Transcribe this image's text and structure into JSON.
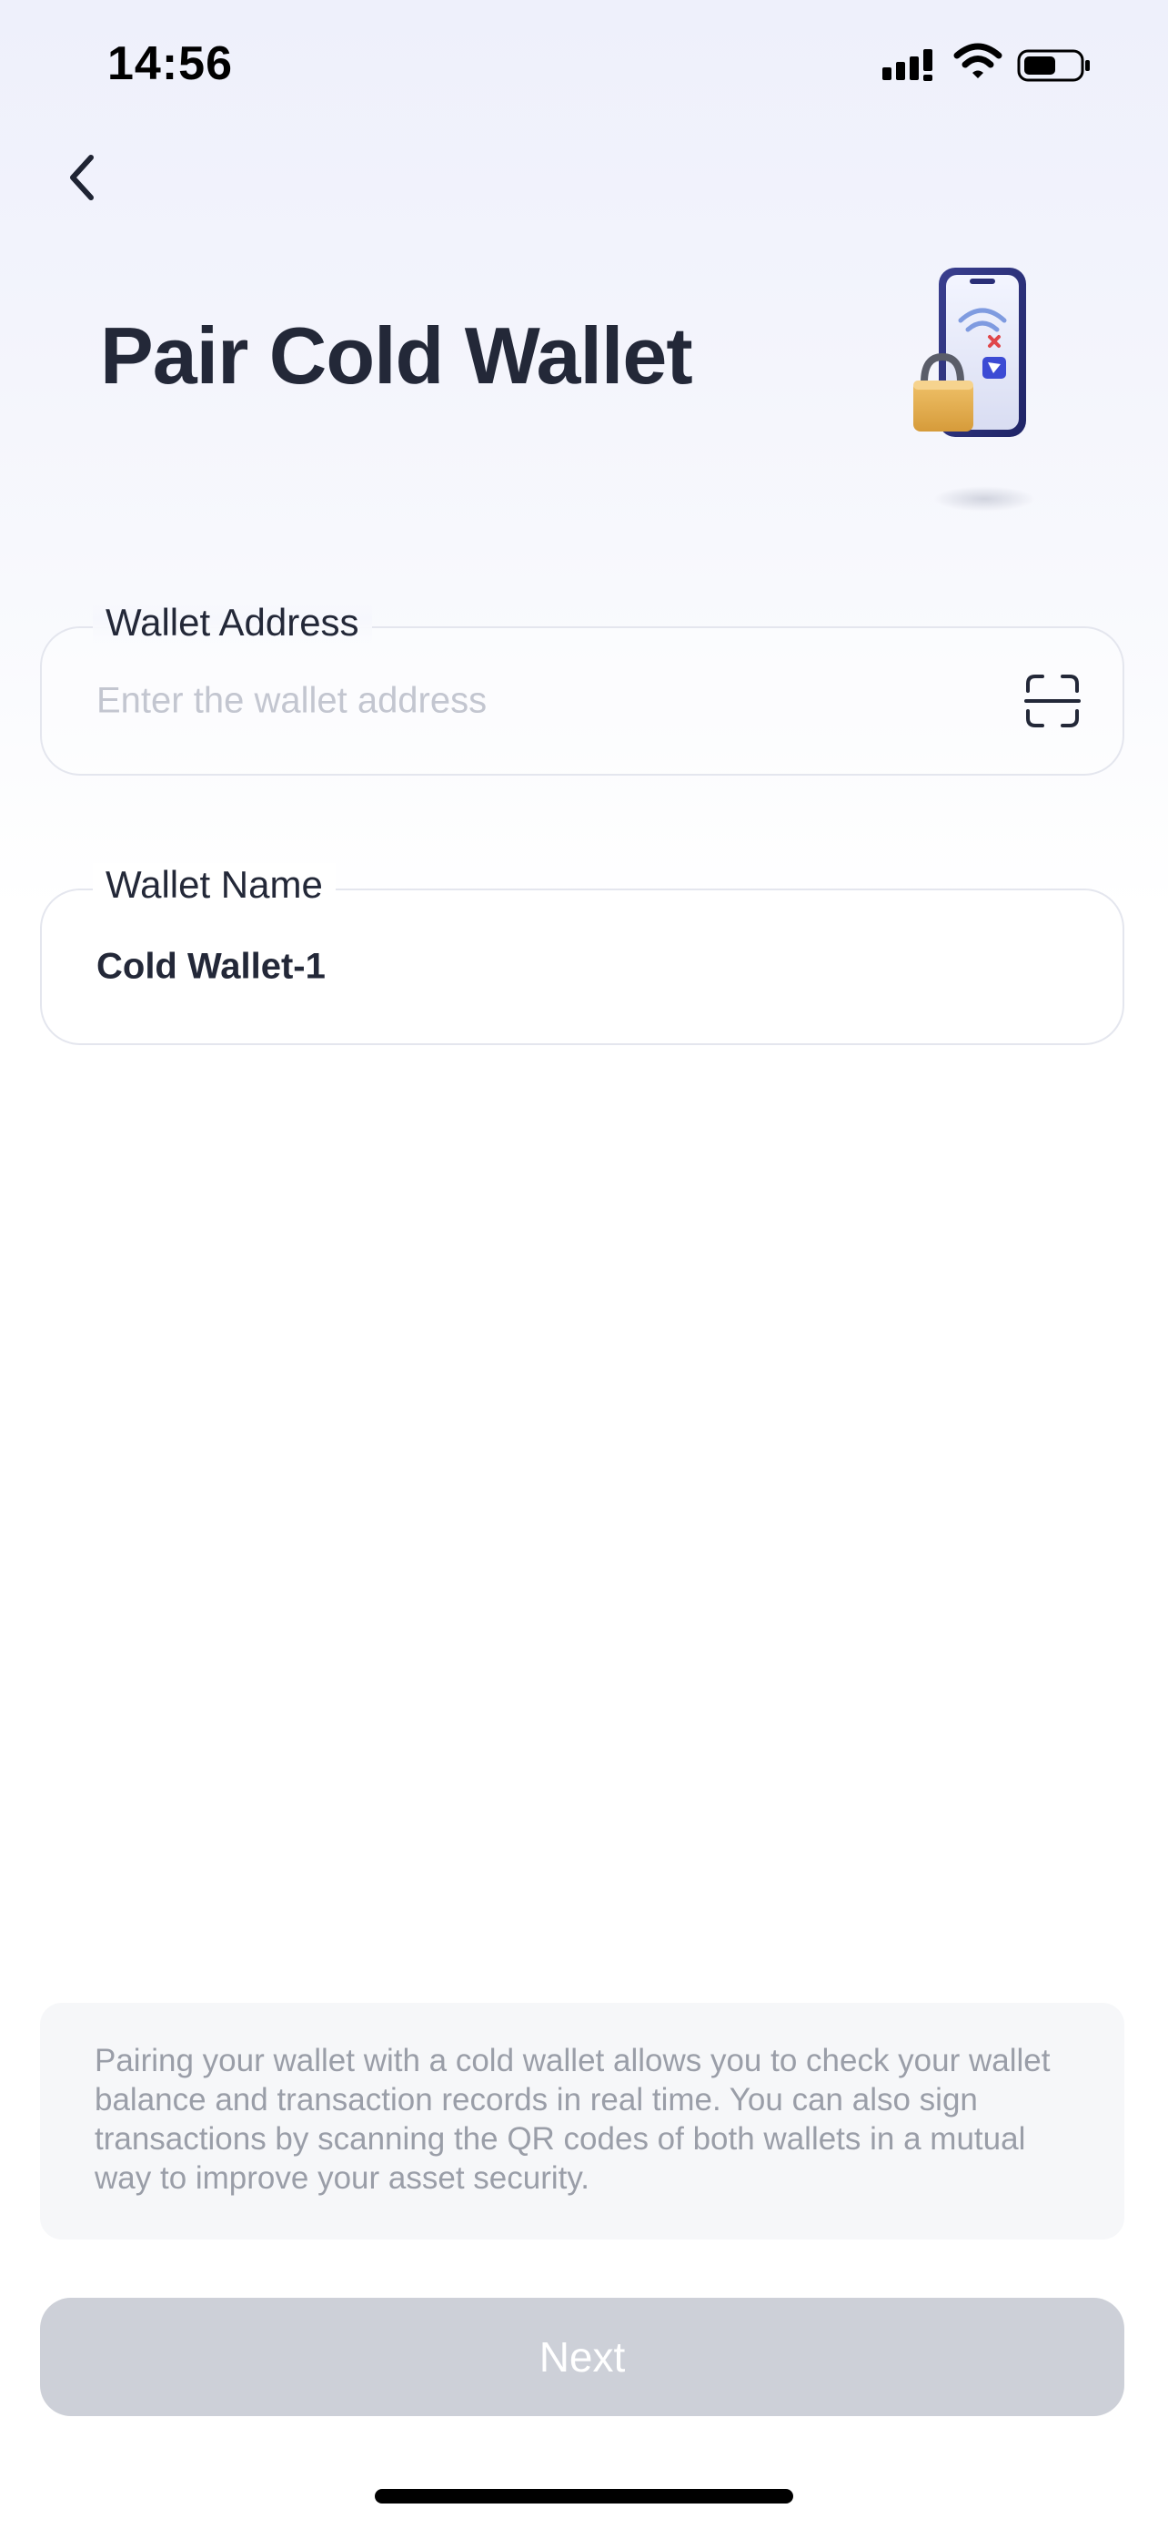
{
  "status_bar": {
    "time": "14:56"
  },
  "header": {
    "title": "Pair Cold Wallet"
  },
  "form": {
    "wallet_address": {
      "label": "Wallet Address",
      "placeholder": "Enter the wallet address",
      "value": ""
    },
    "wallet_name": {
      "label": "Wallet Name",
      "value": "Cold Wallet-1"
    }
  },
  "info": {
    "text": "Pairing your wallet with a cold wallet allows you to check your wallet balance and transaction records in real time. You can also sign transactions by scanning the QR codes of both wallets in a mutual way to improve your asset security."
  },
  "actions": {
    "next_label": "Next"
  },
  "icons": {
    "back": "chevron-left-icon",
    "scan": "scan-icon",
    "signal": "cellular-signal-icon",
    "wifi": "wifi-icon",
    "battery": "battery-icon",
    "illustration": "phone-lock-illustration"
  },
  "colors": {
    "title": "#232838",
    "placeholder": "#c3c6d0",
    "button_disabled": "#cdd0d8",
    "info_bg": "#f6f7f9",
    "info_text": "#9a9ea8"
  }
}
